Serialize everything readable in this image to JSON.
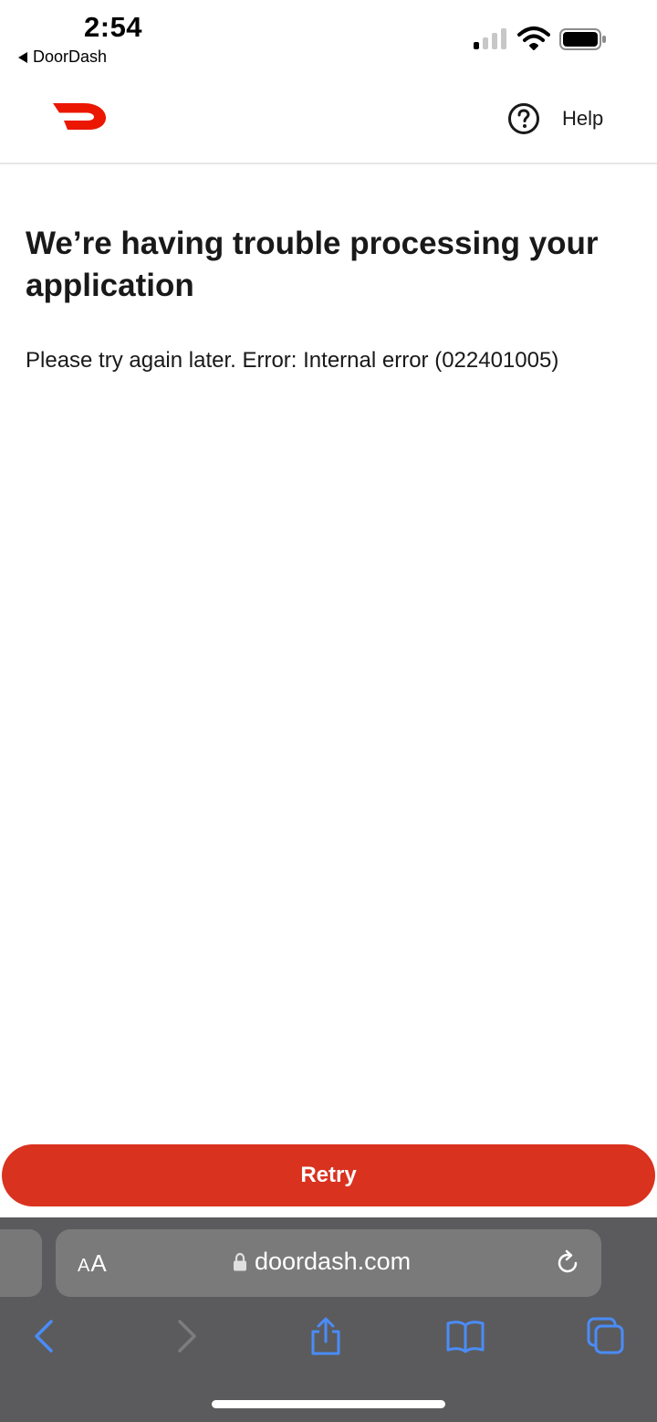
{
  "status_bar": {
    "time": "2:54",
    "back_app_label": "DoorDash"
  },
  "header": {
    "logo_icon": "doordash-logo",
    "brand_color": "#eb1700",
    "help_icon": "question-circle-icon",
    "help_label": "Help"
  },
  "content": {
    "title": "We’re having trouble processing your application",
    "message": "Please try again later. Error: Internal error (022401005)"
  },
  "retry_button": {
    "label": "Retry",
    "color": "#d9321f"
  },
  "browser": {
    "text_size_label_small": "A",
    "text_size_label_large": "A",
    "url": "doordash.com",
    "lock_icon": "lock-icon",
    "reload_icon": "reload-icon",
    "toolbar_icons": [
      "back-icon",
      "forward-icon",
      "share-icon",
      "bookmarks-icon",
      "tabs-icon"
    ],
    "accent_color": "#4a8cf7"
  }
}
